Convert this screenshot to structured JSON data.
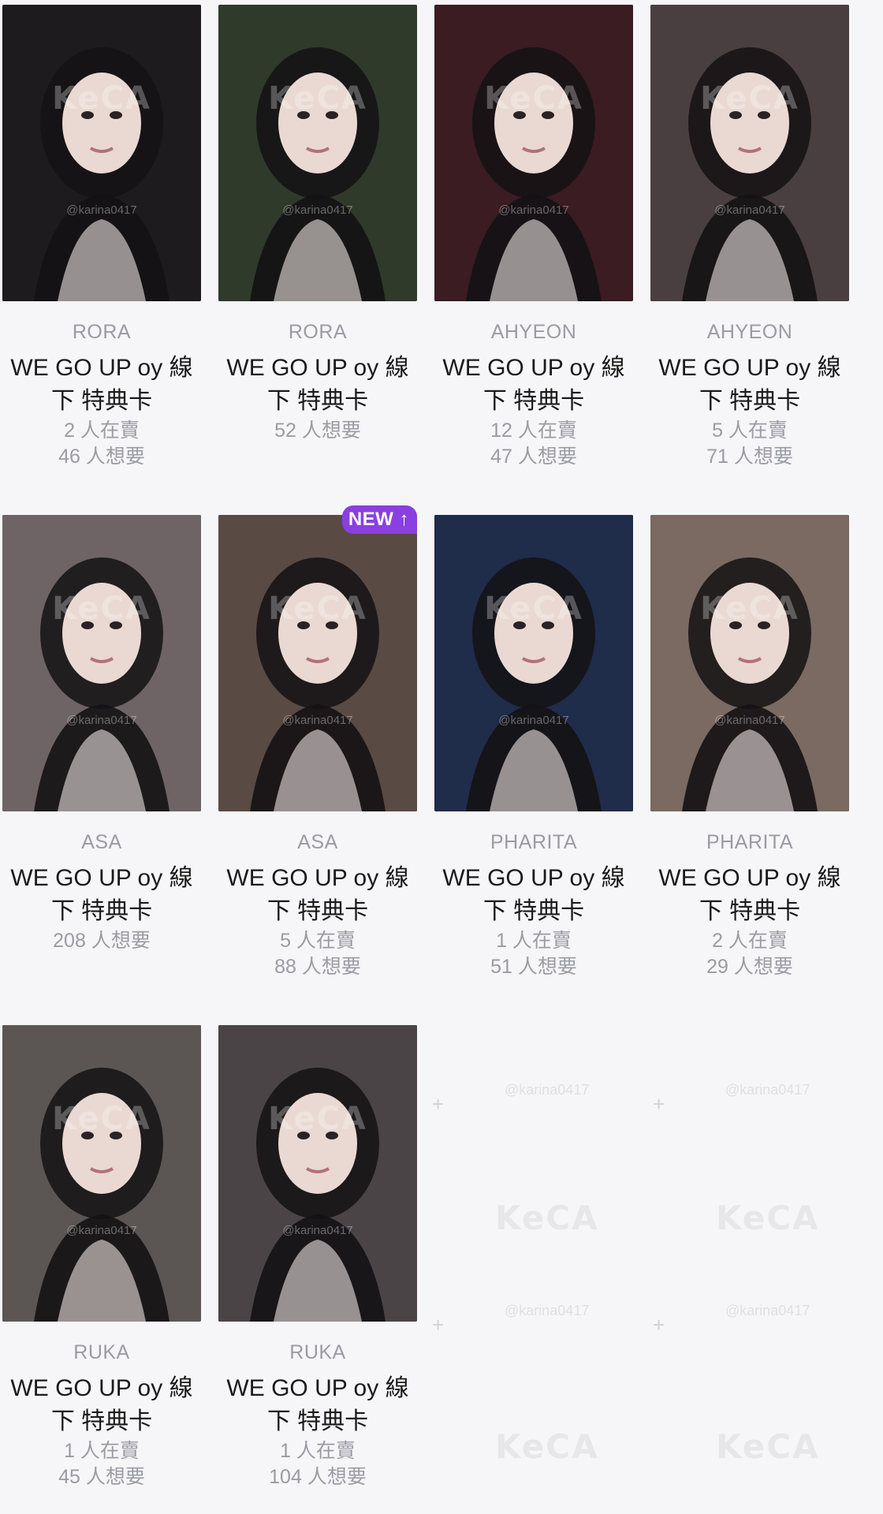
{
  "watermark": "KeCA",
  "handle": "@karina0417",
  "cards": [
    {
      "member": "RORA",
      "title_line1": "WE GO UP oy 線",
      "title_line2": "下 特典卡",
      "stats": [
        "2 人在賣",
        "46 人想要"
      ],
      "badge": "",
      "photo_color": "#1d1b1e"
    },
    {
      "member": "RORA",
      "title_line1": "WE GO UP oy 線",
      "title_line2": "下 特典卡",
      "stats": [
        "52 人想要"
      ],
      "badge": "",
      "photo_color": "#2f3a2a"
    },
    {
      "member": "AHYEON",
      "title_line1": "WE GO UP oy 線",
      "title_line2": "下 特典卡",
      "stats": [
        "12 人在賣",
        "47 人想要"
      ],
      "badge": "",
      "photo_color": "#3a1c22"
    },
    {
      "member": "AHYEON",
      "title_line1": "WE GO UP oy 線",
      "title_line2": "下 特典卡",
      "stats": [
        "5 人在賣",
        "71 人想要"
      ],
      "badge": "",
      "photo_color": "#4a3f40"
    },
    {
      "member": "ASA",
      "title_line1": "WE GO UP oy 線",
      "title_line2": "下 特典卡",
      "stats": [
        "208 人想要"
      ],
      "badge": "",
      "photo_color": "#6e6466"
    },
    {
      "member": "ASA",
      "title_line1": "WE GO UP oy 線",
      "title_line2": "下 特典卡",
      "stats": [
        "5 人在賣",
        "88 人想要"
      ],
      "badge": "NEW ↑",
      "photo_color": "#5a4a44"
    },
    {
      "member": "PHARITA",
      "title_line1": "WE GO UP oy 線",
      "title_line2": "下 特典卡",
      "stats": [
        "1 人在賣",
        "51 人想要"
      ],
      "badge": "",
      "photo_color": "#1f2c4a"
    },
    {
      "member": "PHARITA",
      "title_line1": "WE GO UP oy 線",
      "title_line2": "下 特典卡",
      "stats": [
        "2 人在賣",
        "29 人想要"
      ],
      "badge": "",
      "photo_color": "#7a6a62"
    },
    {
      "member": "RUKA",
      "title_line1": "WE GO UP oy 線",
      "title_line2": "下 特典卡",
      "stats": [
        "1 人在賣",
        "45 人想要"
      ],
      "badge": "",
      "photo_color": "#5b5654"
    },
    {
      "member": "RUKA",
      "title_line1": "WE GO UP oy 線",
      "title_line2": "下 特典卡",
      "stats": [
        "1 人在賣",
        "104 人想要"
      ],
      "badge": "",
      "photo_color": "#4a4446"
    }
  ]
}
